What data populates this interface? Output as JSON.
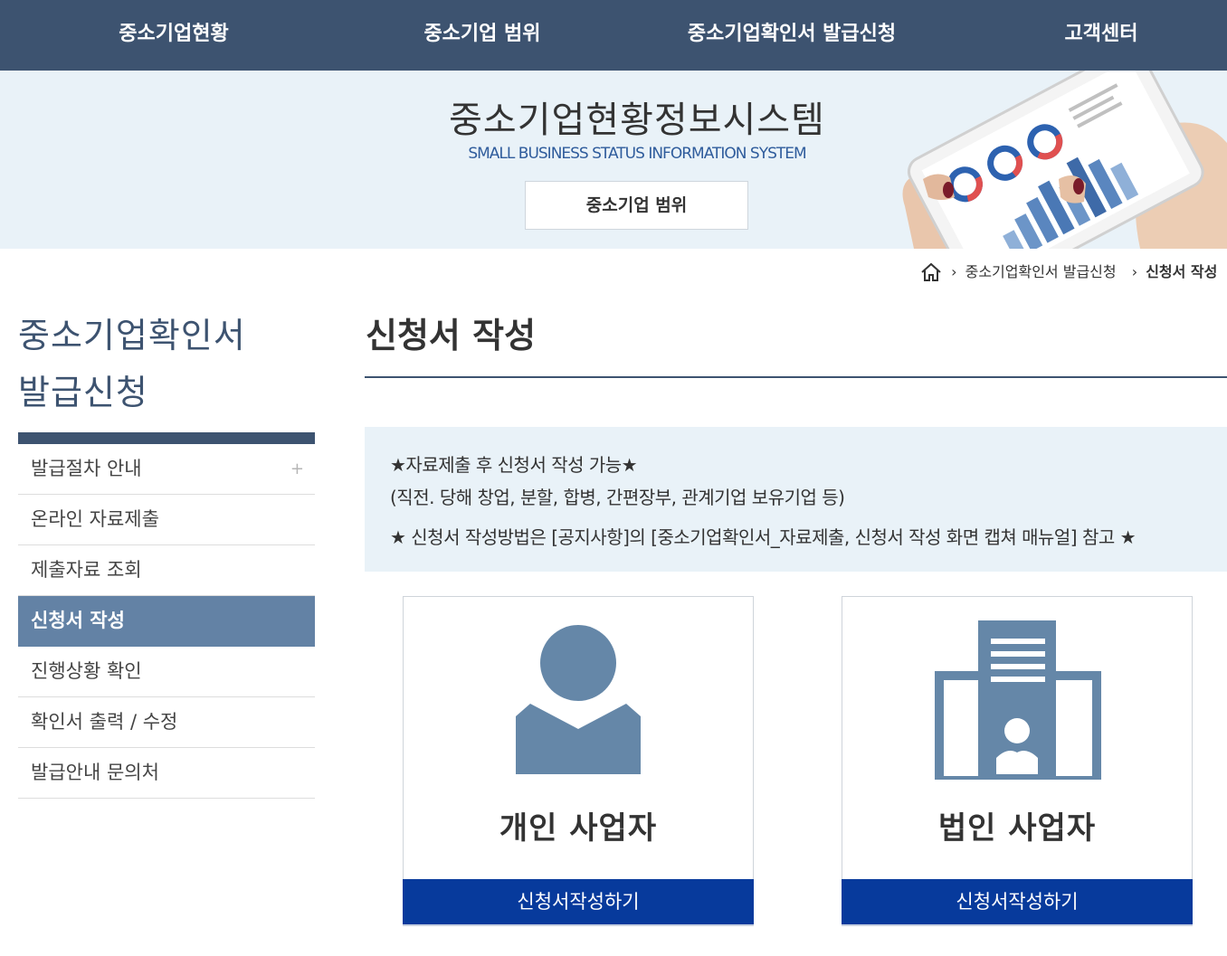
{
  "nav": {
    "items": [
      "중소기업현황",
      "중소기업 범위",
      "중소기업확인서 발급신청",
      "고객센터"
    ]
  },
  "banner": {
    "title": "중소기업현황정보시스템",
    "subtitle": "SMALL BUSINESS STATUS INFORMATION SYSTEM",
    "button_label": "중소기업 범위"
  },
  "breadcrumb": {
    "items": [
      "중소기업확인서 발급신청",
      "신청서 작성"
    ]
  },
  "sidebar": {
    "title_line1": "중소기업확인서",
    "title_line2": "발급신청",
    "items": [
      {
        "label": "발급절차 안내",
        "expand": "+"
      },
      {
        "label": "온라인 자료제출"
      },
      {
        "label": "제출자료 조회"
      },
      {
        "label": "신청서 작성"
      },
      {
        "label": "진행상황 확인"
      },
      {
        "label": "확인서 출력 / 수정"
      },
      {
        "label": "발급안내 문의처"
      }
    ],
    "active_index": 3
  },
  "main": {
    "title": "신청서 작성",
    "notice": {
      "line1": "★자료제출 후 신청서 작성 가능★",
      "line2": "(직전. 당해 창업, 분할, 합병, 간편장부, 관계기업 보유기업 등)",
      "line3": "★ 신청서 작성방법은 [공지사항]의 [중소기업확인서_자료제출, 신청서 작성 화면 캡쳐 매뉴얼] 참고 ★"
    },
    "cards": [
      {
        "label": "개인 사업자",
        "button": "신청서작성하기",
        "icon": "person-icon"
      },
      {
        "label": "법인 사업자",
        "button": "신청서작성하기",
        "icon": "building-icon"
      }
    ]
  },
  "colors": {
    "nav_bg": "#3d5370",
    "banner_bg": "#e9f2f8",
    "icon_color": "#6587a8",
    "button_bg": "#073a9c",
    "active_menu": "#6382a5"
  }
}
